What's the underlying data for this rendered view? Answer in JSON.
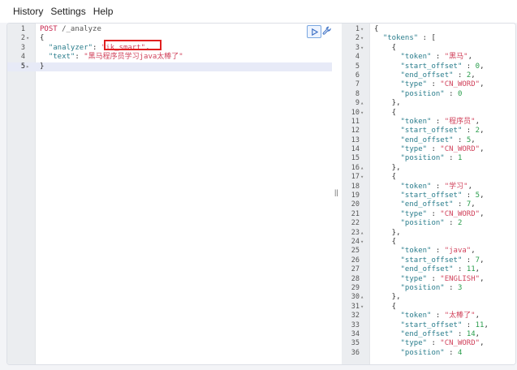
{
  "menu": {
    "items": [
      "History",
      "Settings",
      "Help"
    ]
  },
  "request": {
    "lines": [
      {
        "n": "1",
        "fold": "",
        "parts": [
          [
            "kw",
            "POST "
          ],
          [
            "url",
            "/_analyze"
          ]
        ]
      },
      {
        "n": "2",
        "fold": "▾",
        "parts": [
          [
            "punct",
            "{"
          ]
        ]
      },
      {
        "n": "3",
        "fold": "",
        "parts": [
          [
            "punct",
            "  "
          ],
          [
            "key",
            "\"analyzer\""
          ],
          [
            "punct",
            ": "
          ],
          [
            "str",
            "\"ik_smart\""
          ],
          [
            "punct",
            ","
          ]
        ]
      },
      {
        "n": "4",
        "fold": "",
        "parts": [
          [
            "punct",
            "  "
          ],
          [
            "key",
            "\"text\""
          ],
          [
            "punct",
            ": "
          ],
          [
            "str",
            "\"黑马程序员学习java太棒了\""
          ]
        ]
      },
      {
        "n": "5",
        "fold": "▸",
        "parts": [
          [
            "punct",
            "}"
          ]
        ],
        "active": true
      }
    ]
  },
  "response": {
    "lines": [
      {
        "n": "1",
        "fold": "▾",
        "parts": [
          [
            "punct",
            "{"
          ]
        ]
      },
      {
        "n": "2",
        "fold": "▾",
        "parts": [
          [
            "punct",
            "  "
          ],
          [
            "key",
            "\"tokens\""
          ],
          [
            "punct",
            " : ["
          ]
        ]
      },
      {
        "n": "3",
        "fold": "▾",
        "parts": [
          [
            "punct",
            "    {"
          ]
        ]
      },
      {
        "n": "4",
        "fold": "",
        "parts": [
          [
            "punct",
            "      "
          ],
          [
            "key",
            "\"token\""
          ],
          [
            "punct",
            " : "
          ],
          [
            "str",
            "\"黑马\""
          ],
          [
            "punct",
            ","
          ]
        ]
      },
      {
        "n": "5",
        "fold": "",
        "parts": [
          [
            "punct",
            "      "
          ],
          [
            "key",
            "\"start_offset\""
          ],
          [
            "punct",
            " : "
          ],
          [
            "num",
            "0"
          ],
          [
            "punct",
            ","
          ]
        ]
      },
      {
        "n": "6",
        "fold": "",
        "parts": [
          [
            "punct",
            "      "
          ],
          [
            "key",
            "\"end_offset\""
          ],
          [
            "punct",
            " : "
          ],
          [
            "num",
            "2"
          ],
          [
            "punct",
            ","
          ]
        ]
      },
      {
        "n": "7",
        "fold": "",
        "parts": [
          [
            "punct",
            "      "
          ],
          [
            "key",
            "\"type\""
          ],
          [
            "punct",
            " : "
          ],
          [
            "str",
            "\"CN_WORD\""
          ],
          [
            "punct",
            ","
          ]
        ]
      },
      {
        "n": "8",
        "fold": "",
        "parts": [
          [
            "punct",
            "      "
          ],
          [
            "key",
            "\"position\""
          ],
          [
            "punct",
            " : "
          ],
          [
            "num",
            "0"
          ]
        ]
      },
      {
        "n": "9",
        "fold": "▴",
        "parts": [
          [
            "punct",
            "    },"
          ]
        ]
      },
      {
        "n": "10",
        "fold": "▾",
        "parts": [
          [
            "punct",
            "    {"
          ]
        ]
      },
      {
        "n": "11",
        "fold": "",
        "parts": [
          [
            "punct",
            "      "
          ],
          [
            "key",
            "\"token\""
          ],
          [
            "punct",
            " : "
          ],
          [
            "str",
            "\"程序员\""
          ],
          [
            "punct",
            ","
          ]
        ]
      },
      {
        "n": "12",
        "fold": "",
        "parts": [
          [
            "punct",
            "      "
          ],
          [
            "key",
            "\"start_offset\""
          ],
          [
            "punct",
            " : "
          ],
          [
            "num",
            "2"
          ],
          [
            "punct",
            ","
          ]
        ]
      },
      {
        "n": "13",
        "fold": "",
        "parts": [
          [
            "punct",
            "      "
          ],
          [
            "key",
            "\"end_offset\""
          ],
          [
            "punct",
            " : "
          ],
          [
            "num",
            "5"
          ],
          [
            "punct",
            ","
          ]
        ]
      },
      {
        "n": "14",
        "fold": "",
        "parts": [
          [
            "punct",
            "      "
          ],
          [
            "key",
            "\"type\""
          ],
          [
            "punct",
            " : "
          ],
          [
            "str",
            "\"CN_WORD\""
          ],
          [
            "punct",
            ","
          ]
        ]
      },
      {
        "n": "15",
        "fold": "",
        "parts": [
          [
            "punct",
            "      "
          ],
          [
            "key",
            "\"position\""
          ],
          [
            "punct",
            " : "
          ],
          [
            "num",
            "1"
          ]
        ]
      },
      {
        "n": "16",
        "fold": "▴",
        "parts": [
          [
            "punct",
            "    },"
          ]
        ]
      },
      {
        "n": "17",
        "fold": "▾",
        "parts": [
          [
            "punct",
            "    {"
          ]
        ]
      },
      {
        "n": "18",
        "fold": "",
        "parts": [
          [
            "punct",
            "      "
          ],
          [
            "key",
            "\"token\""
          ],
          [
            "punct",
            " : "
          ],
          [
            "str",
            "\"学习\""
          ],
          [
            "punct",
            ","
          ]
        ]
      },
      {
        "n": "19",
        "fold": "",
        "parts": [
          [
            "punct",
            "      "
          ],
          [
            "key",
            "\"start_offset\""
          ],
          [
            "punct",
            " : "
          ],
          [
            "num",
            "5"
          ],
          [
            "punct",
            ","
          ]
        ]
      },
      {
        "n": "20",
        "fold": "",
        "parts": [
          [
            "punct",
            "      "
          ],
          [
            "key",
            "\"end_offset\""
          ],
          [
            "punct",
            " : "
          ],
          [
            "num",
            "7"
          ],
          [
            "punct",
            ","
          ]
        ]
      },
      {
        "n": "21",
        "fold": "",
        "parts": [
          [
            "punct",
            "      "
          ],
          [
            "key",
            "\"type\""
          ],
          [
            "punct",
            " : "
          ],
          [
            "str",
            "\"CN_WORD\""
          ],
          [
            "punct",
            ","
          ]
        ]
      },
      {
        "n": "22",
        "fold": "",
        "parts": [
          [
            "punct",
            "      "
          ],
          [
            "key",
            "\"position\""
          ],
          [
            "punct",
            " : "
          ],
          [
            "num",
            "2"
          ]
        ]
      },
      {
        "n": "23",
        "fold": "▴",
        "parts": [
          [
            "punct",
            "    },"
          ]
        ]
      },
      {
        "n": "24",
        "fold": "▾",
        "parts": [
          [
            "punct",
            "    {"
          ]
        ]
      },
      {
        "n": "25",
        "fold": "",
        "parts": [
          [
            "punct",
            "      "
          ],
          [
            "key",
            "\"token\""
          ],
          [
            "punct",
            " : "
          ],
          [
            "str",
            "\"java\""
          ],
          [
            "punct",
            ","
          ]
        ]
      },
      {
        "n": "26",
        "fold": "",
        "parts": [
          [
            "punct",
            "      "
          ],
          [
            "key",
            "\"start_offset\""
          ],
          [
            "punct",
            " : "
          ],
          [
            "num",
            "7"
          ],
          [
            "punct",
            ","
          ]
        ]
      },
      {
        "n": "27",
        "fold": "",
        "parts": [
          [
            "punct",
            "      "
          ],
          [
            "key",
            "\"end_offset\""
          ],
          [
            "punct",
            " : "
          ],
          [
            "num",
            "11"
          ],
          [
            "punct",
            ","
          ]
        ]
      },
      {
        "n": "28",
        "fold": "",
        "parts": [
          [
            "punct",
            "      "
          ],
          [
            "key",
            "\"type\""
          ],
          [
            "punct",
            " : "
          ],
          [
            "str",
            "\"ENGLISH\""
          ],
          [
            "punct",
            ","
          ]
        ]
      },
      {
        "n": "29",
        "fold": "",
        "parts": [
          [
            "punct",
            "      "
          ],
          [
            "key",
            "\"position\""
          ],
          [
            "punct",
            " : "
          ],
          [
            "num",
            "3"
          ]
        ]
      },
      {
        "n": "30",
        "fold": "▴",
        "parts": [
          [
            "punct",
            "    },"
          ]
        ]
      },
      {
        "n": "31",
        "fold": "▾",
        "parts": [
          [
            "punct",
            "    {"
          ]
        ]
      },
      {
        "n": "32",
        "fold": "",
        "parts": [
          [
            "punct",
            "      "
          ],
          [
            "key",
            "\"token\""
          ],
          [
            "punct",
            " : "
          ],
          [
            "str",
            "\"太棒了\""
          ],
          [
            "punct",
            ","
          ]
        ]
      },
      {
        "n": "33",
        "fold": "",
        "parts": [
          [
            "punct",
            "      "
          ],
          [
            "key",
            "\"start_offset\""
          ],
          [
            "punct",
            " : "
          ],
          [
            "num",
            "11"
          ],
          [
            "punct",
            ","
          ]
        ]
      },
      {
        "n": "34",
        "fold": "",
        "parts": [
          [
            "punct",
            "      "
          ],
          [
            "key",
            "\"end_offset\""
          ],
          [
            "punct",
            " : "
          ],
          [
            "num",
            "14"
          ],
          [
            "punct",
            ","
          ]
        ]
      },
      {
        "n": "35",
        "fold": "",
        "parts": [
          [
            "punct",
            "      "
          ],
          [
            "key",
            "\"type\""
          ],
          [
            "punct",
            " : "
          ],
          [
            "str",
            "\"CN_WORD\""
          ],
          [
            "punct",
            ","
          ]
        ]
      },
      {
        "n": "36",
        "fold": "",
        "parts": [
          [
            "punct",
            "      "
          ],
          [
            "key",
            "\"position\""
          ],
          [
            "punct",
            " : "
          ],
          [
            "num",
            "4"
          ]
        ]
      }
    ]
  },
  "toolbar": {
    "run_icon": "play-icon",
    "settings_icon": "wrench-icon"
  },
  "splitter": {
    "grip": "||"
  },
  "colors": {
    "keyword": "#c7254e",
    "key": "#2a7d8c",
    "string": "#d1445d",
    "number": "#2a9d4c",
    "highlight": "#e02020",
    "accent": "#7aa7e0"
  }
}
